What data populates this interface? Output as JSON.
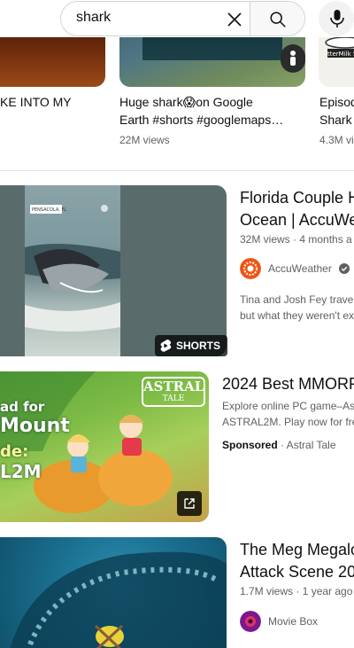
{
  "search": {
    "query": "shark",
    "clear_icon": "close-icon",
    "search_icon": "search-icon",
    "mic_icon": "microphone-icon"
  },
  "shorts": [
    {
      "title_line1": "KE INTO MY",
      "title_line2": "",
      "views": ""
    },
    {
      "title_line1": "Huge shark😱on Google",
      "title_line2": "Earth #shorts #googlemaps…",
      "views": "22M views"
    },
    {
      "title_line1": "Episod",
      "title_line2": "Shark",
      "views": "4.3M vi",
      "thumb_label": "tterMilk S"
    }
  ],
  "videos": [
    {
      "title_line1": "Florida Couple H",
      "title_line2": "Ocean | AccuWe",
      "meta": "32M views · 4 months a",
      "channel": "AccuWeather",
      "desc_line1": "Tina and Josh Fey travel",
      "desc_line2": "but what they weren't ex",
      "badge": "SHORTS",
      "thumb_caption": "PENSACOLA, FL"
    },
    {
      "title_line1": "2024 Best MMORP",
      "desc_line1": "Explore online PC game–As",
      "desc_line2": "ASTRAL2M. Play now for fre",
      "sponsored_label": "Sponsored",
      "advertiser": "· Astral Tale",
      "ad_line1": "ad for",
      "ad_line2": "Mount",
      "ad_line3": "de:",
      "ad_line4": "L2M",
      "logo_main": "ASTRAL",
      "logo_sub": "TALE"
    },
    {
      "title_line1": "The Meg Megalo",
      "title_line2": "Attack Scene 20",
      "meta": "1.7M views · 1 year ago",
      "channel": "Movie Box"
    }
  ],
  "colors": {
    "accuweather": "#f05514",
    "moviebox": "#7a1a8c",
    "text_secondary": "#606060"
  }
}
